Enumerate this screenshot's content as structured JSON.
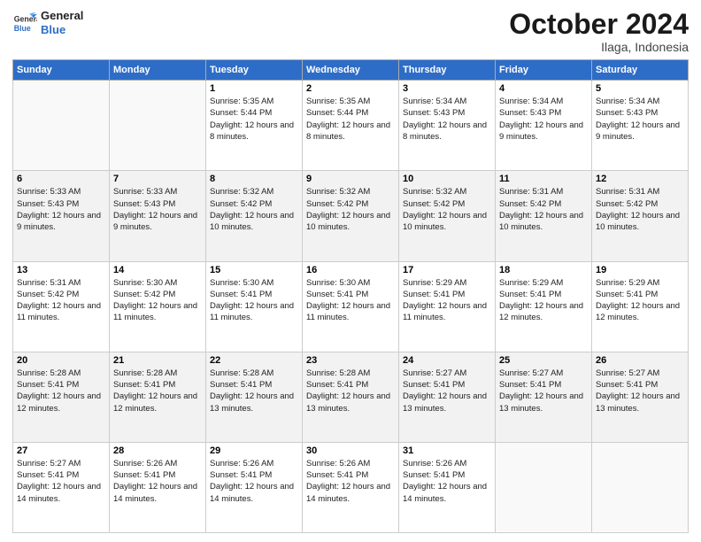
{
  "header": {
    "logo_line1": "General",
    "logo_line2": "Blue",
    "month": "October 2024",
    "location": "Ilaga, Indonesia"
  },
  "weekdays": [
    "Sunday",
    "Monday",
    "Tuesday",
    "Wednesday",
    "Thursday",
    "Friday",
    "Saturday"
  ],
  "weeks": [
    [
      {
        "day": null,
        "sunrise": "",
        "sunset": "",
        "daylight": ""
      },
      {
        "day": null,
        "sunrise": "",
        "sunset": "",
        "daylight": ""
      },
      {
        "day": 1,
        "sunrise": "Sunrise: 5:35 AM",
        "sunset": "Sunset: 5:44 PM",
        "daylight": "Daylight: 12 hours and 8 minutes."
      },
      {
        "day": 2,
        "sunrise": "Sunrise: 5:35 AM",
        "sunset": "Sunset: 5:44 PM",
        "daylight": "Daylight: 12 hours and 8 minutes."
      },
      {
        "day": 3,
        "sunrise": "Sunrise: 5:34 AM",
        "sunset": "Sunset: 5:43 PM",
        "daylight": "Daylight: 12 hours and 8 minutes."
      },
      {
        "day": 4,
        "sunrise": "Sunrise: 5:34 AM",
        "sunset": "Sunset: 5:43 PM",
        "daylight": "Daylight: 12 hours and 9 minutes."
      },
      {
        "day": 5,
        "sunrise": "Sunrise: 5:34 AM",
        "sunset": "Sunset: 5:43 PM",
        "daylight": "Daylight: 12 hours and 9 minutes."
      }
    ],
    [
      {
        "day": 6,
        "sunrise": "Sunrise: 5:33 AM",
        "sunset": "Sunset: 5:43 PM",
        "daylight": "Daylight: 12 hours and 9 minutes."
      },
      {
        "day": 7,
        "sunrise": "Sunrise: 5:33 AM",
        "sunset": "Sunset: 5:43 PM",
        "daylight": "Daylight: 12 hours and 9 minutes."
      },
      {
        "day": 8,
        "sunrise": "Sunrise: 5:32 AM",
        "sunset": "Sunset: 5:42 PM",
        "daylight": "Daylight: 12 hours and 10 minutes."
      },
      {
        "day": 9,
        "sunrise": "Sunrise: 5:32 AM",
        "sunset": "Sunset: 5:42 PM",
        "daylight": "Daylight: 12 hours and 10 minutes."
      },
      {
        "day": 10,
        "sunrise": "Sunrise: 5:32 AM",
        "sunset": "Sunset: 5:42 PM",
        "daylight": "Daylight: 12 hours and 10 minutes."
      },
      {
        "day": 11,
        "sunrise": "Sunrise: 5:31 AM",
        "sunset": "Sunset: 5:42 PM",
        "daylight": "Daylight: 12 hours and 10 minutes."
      },
      {
        "day": 12,
        "sunrise": "Sunrise: 5:31 AM",
        "sunset": "Sunset: 5:42 PM",
        "daylight": "Daylight: 12 hours and 10 minutes."
      }
    ],
    [
      {
        "day": 13,
        "sunrise": "Sunrise: 5:31 AM",
        "sunset": "Sunset: 5:42 PM",
        "daylight": "Daylight: 12 hours and 11 minutes."
      },
      {
        "day": 14,
        "sunrise": "Sunrise: 5:30 AM",
        "sunset": "Sunset: 5:42 PM",
        "daylight": "Daylight: 12 hours and 11 minutes."
      },
      {
        "day": 15,
        "sunrise": "Sunrise: 5:30 AM",
        "sunset": "Sunset: 5:41 PM",
        "daylight": "Daylight: 12 hours and 11 minutes."
      },
      {
        "day": 16,
        "sunrise": "Sunrise: 5:30 AM",
        "sunset": "Sunset: 5:41 PM",
        "daylight": "Daylight: 12 hours and 11 minutes."
      },
      {
        "day": 17,
        "sunrise": "Sunrise: 5:29 AM",
        "sunset": "Sunset: 5:41 PM",
        "daylight": "Daylight: 12 hours and 11 minutes."
      },
      {
        "day": 18,
        "sunrise": "Sunrise: 5:29 AM",
        "sunset": "Sunset: 5:41 PM",
        "daylight": "Daylight: 12 hours and 12 minutes."
      },
      {
        "day": 19,
        "sunrise": "Sunrise: 5:29 AM",
        "sunset": "Sunset: 5:41 PM",
        "daylight": "Daylight: 12 hours and 12 minutes."
      }
    ],
    [
      {
        "day": 20,
        "sunrise": "Sunrise: 5:28 AM",
        "sunset": "Sunset: 5:41 PM",
        "daylight": "Daylight: 12 hours and 12 minutes."
      },
      {
        "day": 21,
        "sunrise": "Sunrise: 5:28 AM",
        "sunset": "Sunset: 5:41 PM",
        "daylight": "Daylight: 12 hours and 12 minutes."
      },
      {
        "day": 22,
        "sunrise": "Sunrise: 5:28 AM",
        "sunset": "Sunset: 5:41 PM",
        "daylight": "Daylight: 12 hours and 13 minutes."
      },
      {
        "day": 23,
        "sunrise": "Sunrise: 5:28 AM",
        "sunset": "Sunset: 5:41 PM",
        "daylight": "Daylight: 12 hours and 13 minutes."
      },
      {
        "day": 24,
        "sunrise": "Sunrise: 5:27 AM",
        "sunset": "Sunset: 5:41 PM",
        "daylight": "Daylight: 12 hours and 13 minutes."
      },
      {
        "day": 25,
        "sunrise": "Sunrise: 5:27 AM",
        "sunset": "Sunset: 5:41 PM",
        "daylight": "Daylight: 12 hours and 13 minutes."
      },
      {
        "day": 26,
        "sunrise": "Sunrise: 5:27 AM",
        "sunset": "Sunset: 5:41 PM",
        "daylight": "Daylight: 12 hours and 13 minutes."
      }
    ],
    [
      {
        "day": 27,
        "sunrise": "Sunrise: 5:27 AM",
        "sunset": "Sunset: 5:41 PM",
        "daylight": "Daylight: 12 hours and 14 minutes."
      },
      {
        "day": 28,
        "sunrise": "Sunrise: 5:26 AM",
        "sunset": "Sunset: 5:41 PM",
        "daylight": "Daylight: 12 hours and 14 minutes."
      },
      {
        "day": 29,
        "sunrise": "Sunrise: 5:26 AM",
        "sunset": "Sunset: 5:41 PM",
        "daylight": "Daylight: 12 hours and 14 minutes."
      },
      {
        "day": 30,
        "sunrise": "Sunrise: 5:26 AM",
        "sunset": "Sunset: 5:41 PM",
        "daylight": "Daylight: 12 hours and 14 minutes."
      },
      {
        "day": 31,
        "sunrise": "Sunrise: 5:26 AM",
        "sunset": "Sunset: 5:41 PM",
        "daylight": "Daylight: 12 hours and 14 minutes."
      },
      {
        "day": null,
        "sunrise": "",
        "sunset": "",
        "daylight": ""
      },
      {
        "day": null,
        "sunrise": "",
        "sunset": "",
        "daylight": ""
      }
    ]
  ]
}
